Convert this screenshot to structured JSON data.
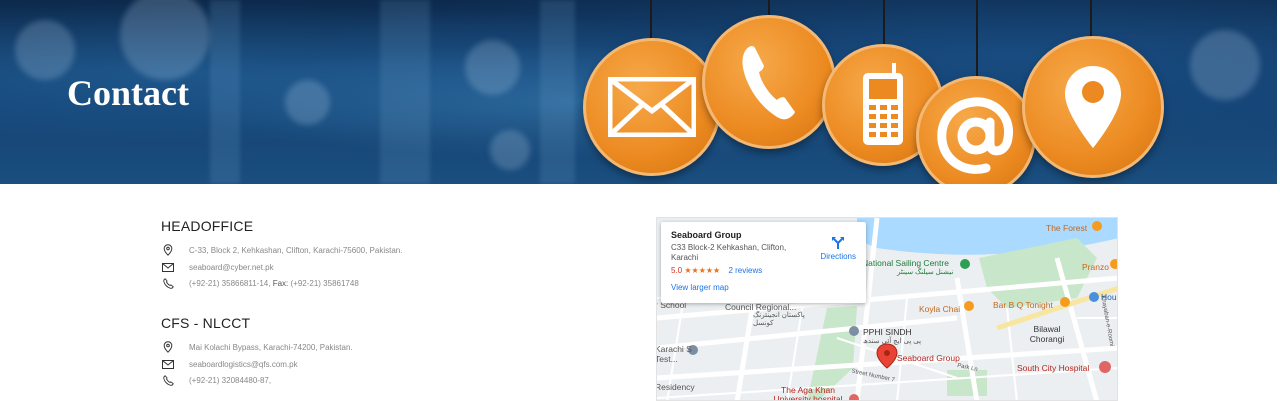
{
  "hero": {
    "title": "Contact",
    "icons": [
      "mail-icon",
      "phone-icon",
      "mobile-icon",
      "at-icon",
      "location-pin-icon"
    ]
  },
  "offices": [
    {
      "title": "HEADOFFICE",
      "address": "C-33, Block 2, Kehkashan, Clifton, Karachi-75600, Pakistan.",
      "email": "seaboard@cyber.net.pk",
      "phone": "(+92-21) 35866811-14,",
      "fax_label": "Fax:",
      "fax": "(+92-21) 35861748"
    },
    {
      "title": "CFS - NLCCT",
      "address": "Mai Kolachi Bypass, Karachi-74200, Pakistan.",
      "email": "seaboardlogistics@qfs.com.pk",
      "phone": "(+92-21) 32084480-87,"
    }
  ],
  "map": {
    "card": {
      "name": "Seaboard Group",
      "address": "C33 Block-2 Kehkashan, Clifton, Karachi",
      "rating": "5.0",
      "stars": "★★★★★",
      "reviews": "2 reviews",
      "larger_map": "View larger map",
      "directions": "Directions"
    },
    "labels": {
      "the_forest": "The Forest",
      "sailing": "National Sailing Centre",
      "sailing_urdu": "نیشنل سیلنگ سینٹر",
      "pranzo": "Pranzo",
      "koyla": "Koyla Chai",
      "bbq": "Bar B Q Tonight",
      "hou": "Hou",
      "council": "Council Regional...",
      "council_urdu": "پاکستان انجینئرنگ کونسل",
      "school": "r School",
      "pphi": "PPHI SINDH",
      "pphi_urdu": "پی پی ایچ آئی سندھ",
      "karachi_test": "Karachi S Test...",
      "bilawal": "Bilawal Chorangi",
      "seaboard": "Seaboard Group",
      "south_city": "South City Hospital",
      "residency": "Residency",
      "aga_khan": "The Aga Khan University hospital",
      "street7": "Street Number 7",
      "park": "Park Ln",
      "khayaban": "Khayaban-e-Roomi"
    }
  },
  "colors": {
    "accent_orange": "#ec8a21",
    "hero_blue": "#134070",
    "map_water": "#aadaff",
    "map_park": "#c8e6c9"
  }
}
